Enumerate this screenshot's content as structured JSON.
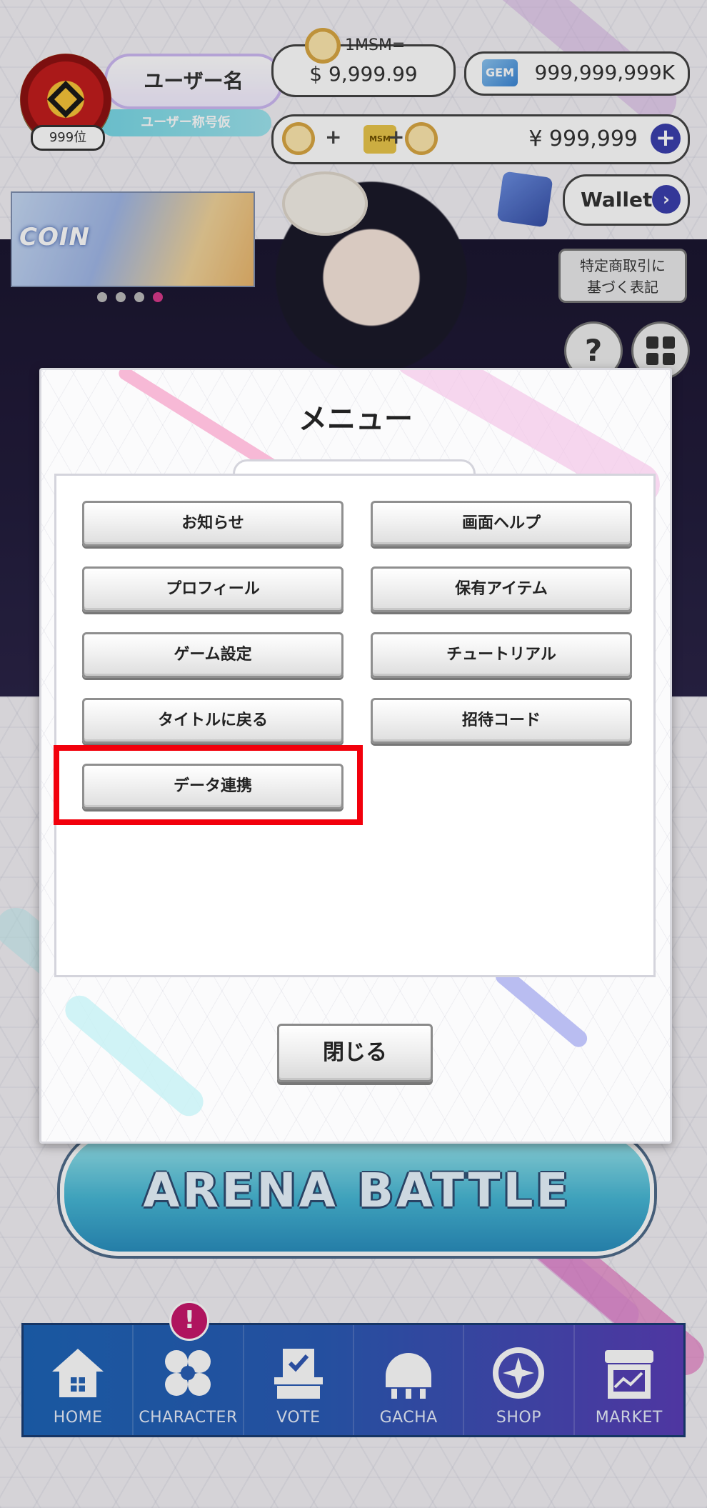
{
  "header": {
    "username": "ユーザー名",
    "user_title": "ユーザー称号仮",
    "rank": "999位",
    "rate_label": "1MSM=",
    "rate_value": "$ 9,999.99",
    "gem_icon_text": "GEM",
    "gem_value": "999,999,999K",
    "msm_chip": "MSM",
    "currency_value": "¥ 999,999",
    "wallet_label": "Wallet"
  },
  "banner": {
    "text": "COIN"
  },
  "legal_button": {
    "line1": "特定商取引に",
    "line2": "基づく表記"
  },
  "help_button": "?",
  "arena": {
    "label": "ARENA BATTLE"
  },
  "modal": {
    "title": "メニュー",
    "buttons": [
      "お知らせ",
      "画面ヘルプ",
      "プロフィール",
      "保有アイテム",
      "ゲーム設定",
      "チュートリアル",
      "タイトルに戻る",
      "招待コード",
      "データ連携"
    ],
    "close_label": "閉じる"
  },
  "nav": {
    "items": [
      {
        "label": "HOME",
        "icon": "home-icon"
      },
      {
        "label": "CHARACTER",
        "icon": "character-icon",
        "badge": "!"
      },
      {
        "label": "VOTE",
        "icon": "vote-icon"
      },
      {
        "label": "GACHA",
        "icon": "gacha-icon"
      },
      {
        "label": "SHOP",
        "icon": "shop-icon"
      },
      {
        "label": "MARKET",
        "icon": "market-icon"
      }
    ]
  },
  "colors": {
    "accent": "#3b3fae",
    "highlight": "#f2000c",
    "nav_start": "#1d64b7",
    "nav_end": "#5a3eb8"
  }
}
